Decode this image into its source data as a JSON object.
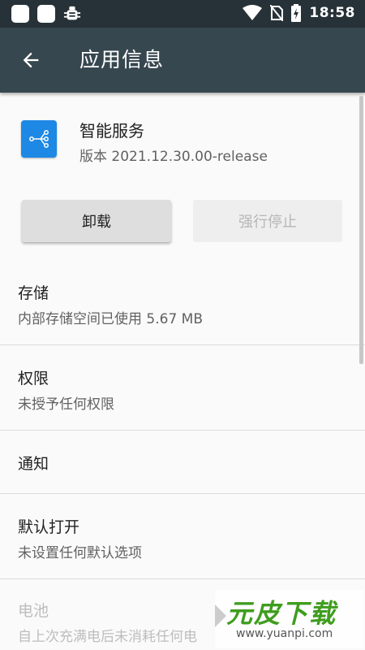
{
  "status_bar": {
    "time": "18:58",
    "icons": [
      "notification-square-icon",
      "notification-square-icon",
      "bug-icon",
      "wifi-icon",
      "no-sim-icon",
      "battery-charging-icon"
    ]
  },
  "app_bar": {
    "title": "应用信息",
    "back_icon": "arrow-back-icon"
  },
  "app": {
    "name": "智能服务",
    "version": "版本 2021.12.30.00-release",
    "icon": "share-nodes-icon",
    "icon_color": "#1e88e5"
  },
  "buttons": {
    "uninstall": "卸载",
    "force_stop": "强行停止"
  },
  "sections": [
    {
      "title": "存储",
      "subtitle": "内部存储空间已使用 5.67 MB"
    },
    {
      "title": "权限",
      "subtitle": "未授予任何权限"
    },
    {
      "title": "通知",
      "subtitle": ""
    },
    {
      "title": "默认打开",
      "subtitle": "未设置任何默认选项"
    },
    {
      "title": "电池",
      "subtitle": "自上次充满电后未消耗任何电"
    }
  ],
  "watermark": {
    "text": "元皮下载",
    "url": "www.yuanpi.com"
  },
  "colors": {
    "status_bar": "#263238",
    "app_bar": "#37474f",
    "background": "#fafafa",
    "watermark_green": "#3f9d1e"
  }
}
